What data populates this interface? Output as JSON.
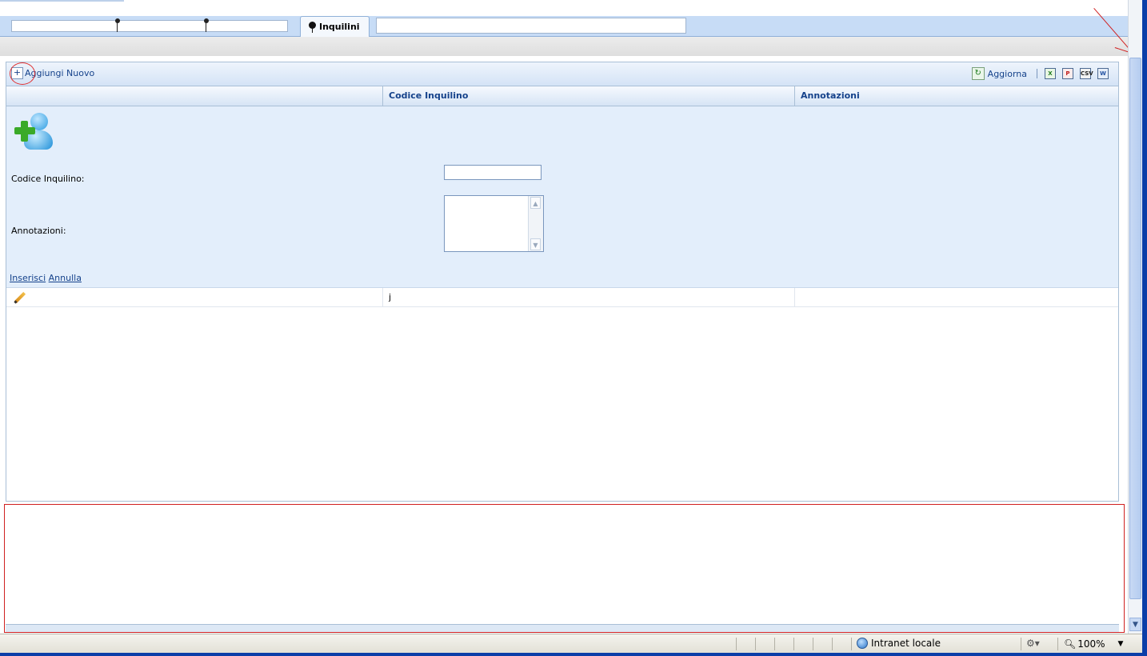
{
  "tabs": {
    "active_label": "Inquilini"
  },
  "toolbar": {
    "add_label": "Aggiungi Nuovo",
    "add_icon": "plus-icon",
    "refresh_label": "Aggiorna",
    "refresh_icon": "refresh-icon",
    "export_icons": [
      "excel-export-icon",
      "pdf-export-icon",
      "csv-export-icon",
      "word-export-icon"
    ]
  },
  "grid": {
    "columns": [
      "",
      "Codice Inquilino",
      "Annotazioni"
    ],
    "rows": [
      {
        "edit_icon": "pencil-icon",
        "codice": "j",
        "annotazioni": ""
      }
    ]
  },
  "form": {
    "icon": "user-add-icon",
    "codice_label": "Codice Inquilino:",
    "codice_value": "",
    "annotazioni_label": "Annotazioni:",
    "annotazioni_value": "",
    "insert_link": "Inserisci",
    "cancel_link": "Annulla"
  },
  "statusbar": {
    "zone_label": "Intranet locale",
    "zoom": "100%"
  },
  "colors": {
    "accent": "#15428b",
    "annotation_red": "#d02020",
    "frame_blue": "#0b3ea8"
  }
}
